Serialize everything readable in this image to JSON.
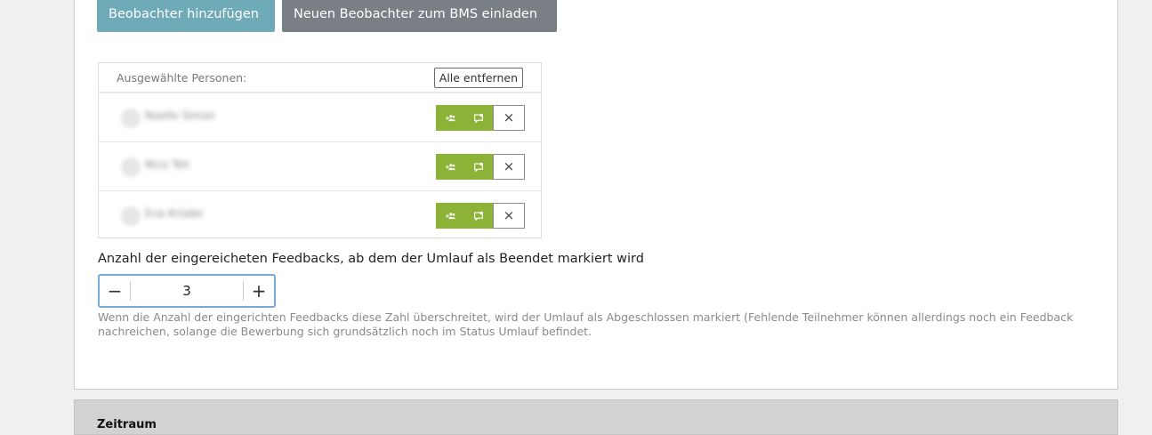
{
  "buttons": {
    "add_observer": "Beobachter hinzufügen",
    "invite_observer": "Neuen Beobachter zum BMS einladen"
  },
  "people": {
    "header_label": "Ausgewählte Personen:",
    "remove_all": "Alle entfernen",
    "rows": [
      {
        "name": "Noelle Simon"
      },
      {
        "name": "Nico Teh"
      },
      {
        "name": "Eva Krüder"
      }
    ],
    "remove_icon": "×"
  },
  "threshold": {
    "label": "Anzahl der eingereicheten Feedbacks, ab dem der Umlauf als Beendet markiert wird",
    "value": "3",
    "minus": "−",
    "plus": "+",
    "hint": "Wenn die Anzahl der eingerichten Feedbacks diese Zahl überschreitet, wird der Umlauf als Abgeschlossen markiert (Fehlende Teilnehmer können allerdings noch ein Feedback nachreichen, solange die Bewerbung sich grundsätzlich noch im Status Umlauf befindet."
  },
  "section_next": {
    "title": "Zeitraum"
  },
  "colors": {
    "add_button": "#6eaab8",
    "invite_button": "#7a7f85",
    "action_green": "#8db238",
    "focus_border": "#78a9d8"
  },
  "icons": {
    "add_group": "group-add-icon",
    "feedback": "feedback-chat-icon",
    "remove": "close-icon"
  }
}
